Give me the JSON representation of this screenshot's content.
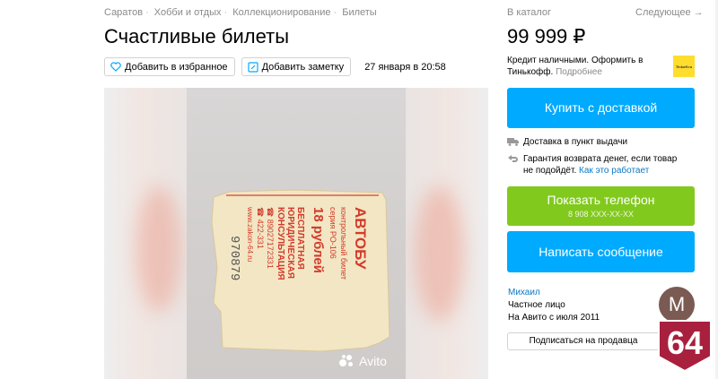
{
  "breadcrumbs": [
    "Саратов",
    "Хобби и отдых",
    "Коллекционирование",
    "Билеты"
  ],
  "title": "Счастливые билеты",
  "actions": {
    "favorite_label": "Добавить в избранное",
    "note_label": "Добавить заметку",
    "date": "27 января в 20:58"
  },
  "gallery": {
    "watermark": "Avito"
  },
  "sidebar": {
    "catalog_link": "В каталог",
    "next_link": "Следующее →",
    "price": "99 999 ₽",
    "credit_text": "Кредит наличными. Оформить в Тинькофф.",
    "credit_more": "Подробнее",
    "tinkoff_logo_text": "Tinkoff.ru",
    "buy_button": "Купить с доставкой",
    "delivery_text": "Доставка в пункт выдачи",
    "guarantee_text": "Гарантия возврата денег, если товар не подойдёт.",
    "guarantee_link": "Как это работает",
    "phone_button": "Показать телефон",
    "phone_masked": "8 908 XXX-XX-XX",
    "message_button": "Написать сообщение"
  },
  "seller": {
    "name": "Михаил",
    "type": "Частное лицо",
    "since": "На Авито с июля 2011",
    "avatar_letter": "М",
    "subscribe_button": "Подписаться на продавца"
  },
  "overlay_badge": "64",
  "colors": {
    "accent_blue": "#00aaff",
    "phone_green": "#82c91e",
    "link_blue": "#0a78c4",
    "badge_red": "#a8203e"
  }
}
